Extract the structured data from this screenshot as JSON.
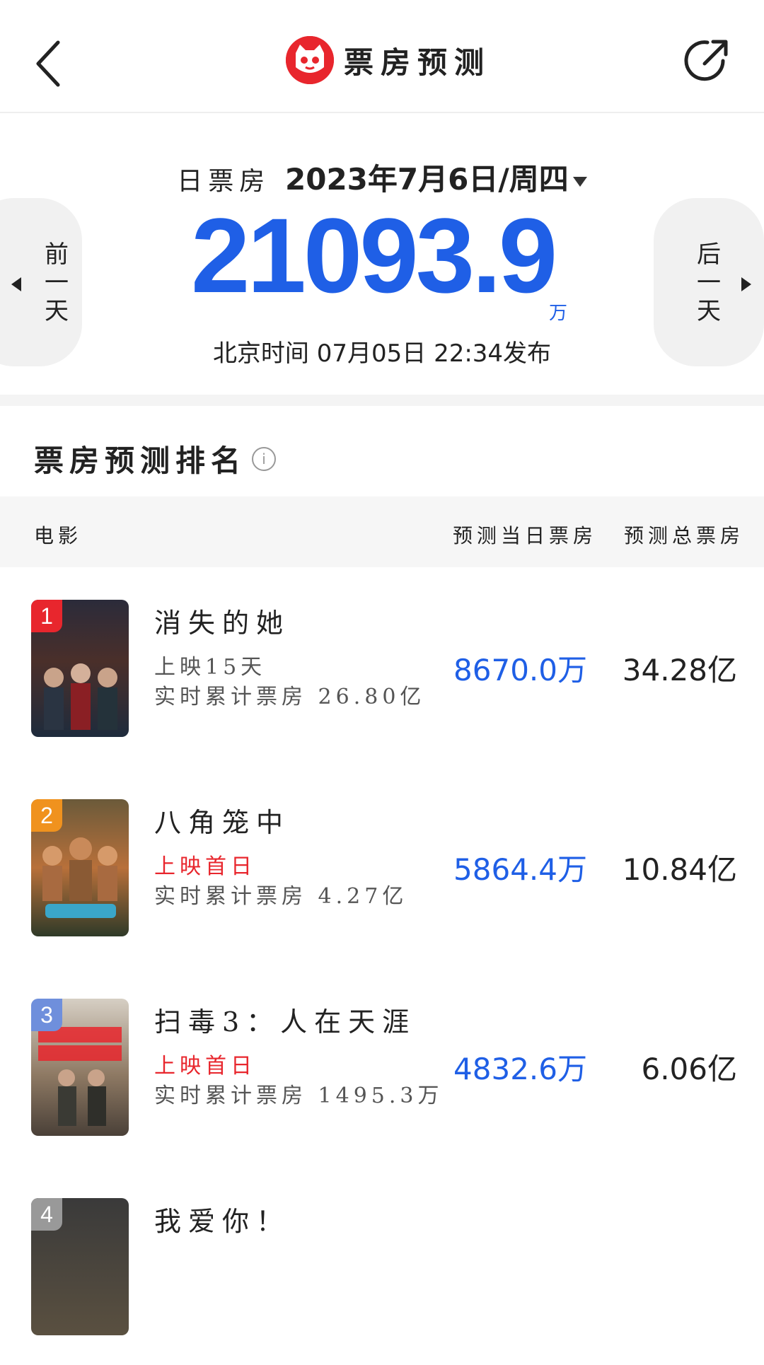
{
  "header": {
    "title": "票房预测",
    "brand_color": "#e8262d"
  },
  "summary": {
    "date_label": "日票房",
    "date_value": "2023年7月6日/周四",
    "amount": "21093.9",
    "unit": "万",
    "publish_info": "北京时间  07月05日  22:34发布",
    "prev_label": "前一天",
    "next_label": "后一天",
    "accent_color": "#1f5fe6"
  },
  "ranking": {
    "title": "票房预测排名",
    "columns": {
      "movie": "电影",
      "daily": "预测当日票房",
      "total": "预测总票房"
    },
    "rows": [
      {
        "rank": "1",
        "name": "消失的她",
        "release": "上映15天",
        "cumulative": "实时累计票房 26.80亿",
        "daily": "8670.0万",
        "total": "34.28亿",
        "badge_color": "#e8262d"
      },
      {
        "rank": "2",
        "name": "八角笼中",
        "release": "上映首日",
        "cumulative": "实时累计票房 4.27亿",
        "daily": "5864.4万",
        "total": "10.84亿",
        "badge_color": "#f0921e"
      },
      {
        "rank": "3",
        "name": "扫毒3：人在天涯",
        "release": "上映首日",
        "cumulative": "实时累计票房 1495.3万",
        "daily": "4832.6万",
        "total": "6.06亿",
        "badge_color": "#6f8fdc"
      },
      {
        "rank": "4",
        "name": "我爱你！",
        "release": "",
        "cumulative": "",
        "daily": "",
        "total": "",
        "badge_color": "#999999"
      }
    ]
  }
}
